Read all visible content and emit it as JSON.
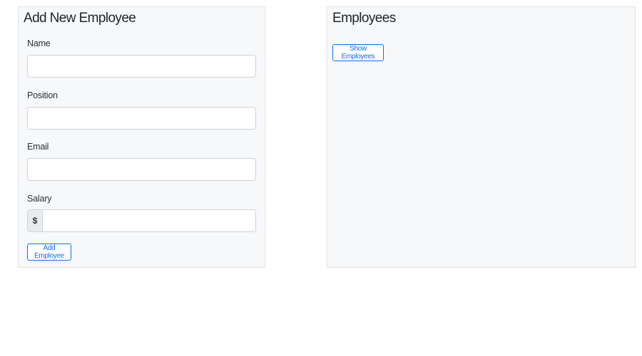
{
  "add_form": {
    "title": "Add New Employee",
    "fields": [
      {
        "label": "Name",
        "value": "",
        "placeholder": ""
      },
      {
        "label": "Position",
        "value": "",
        "placeholder": ""
      },
      {
        "label": "Email",
        "value": "",
        "placeholder": ""
      },
      {
        "label": "Salary",
        "value": "",
        "placeholder": "",
        "prefix": "$"
      }
    ],
    "submit_label": "Add Employee"
  },
  "employees_panel": {
    "title": "Employees",
    "show_label": "Show Employees"
  },
  "colors": {
    "panel_background": "#f7f8fa",
    "panel_border": "#dfe2e6",
    "accent": "#0d6efd"
  }
}
